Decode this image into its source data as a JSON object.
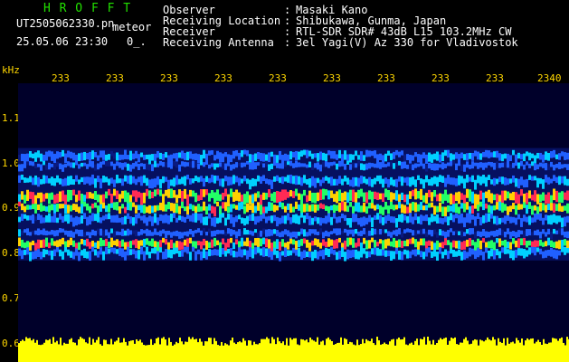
{
  "header": {
    "app_title": "H R O F F T",
    "file_name": "UT2505062330.pn",
    "meteor_label": "meteor",
    "datetime": "25.05.06 23:30",
    "counter": "0_."
  },
  "metadata": [
    {
      "label": "Observer",
      "value": "Masaki Kano"
    },
    {
      "label": "Receiving Location",
      "value": "Shibukawa, Gunma, Japan"
    },
    {
      "label": "Receiver",
      "value": "RTL-SDR SDR# 43dB L15 103.2MHz CW"
    },
    {
      "label": "Receiving Antenna",
      "value": "3el Yagi(V) Az 330 for Vladivostok"
    }
  ],
  "separator": ":",
  "axis": {
    "unit": "kHz",
    "time_ticks": [
      "233",
      "233",
      "233",
      "233",
      "233",
      "233",
      "233",
      "233",
      "233",
      "2340"
    ],
    "freq_labels": [
      "1.1",
      "1.0",
      "0.9",
      "0.8",
      "0.7",
      "0.6"
    ]
  },
  "colors": {
    "title_green": "#22e000",
    "axis_yellow": "#ffd700",
    "signal_yellow": "#ffff00"
  },
  "spectrogram": {
    "freq_min_khz": 0.6,
    "freq_max_khz": 1.1,
    "bands": [
      {
        "center_khz": 1.02,
        "width_khz": 0.02,
        "level": 0.45
      },
      {
        "center_khz": 1.0,
        "width_khz": 0.015,
        "level": 0.4
      },
      {
        "center_khz": 0.965,
        "width_khz": 0.02,
        "level": 0.5
      },
      {
        "center_khz": 0.93,
        "width_khz": 0.025,
        "level": 0.95
      },
      {
        "center_khz": 0.905,
        "width_khz": 0.02,
        "level": 0.85
      },
      {
        "center_khz": 0.88,
        "width_khz": 0.02,
        "level": 0.45
      },
      {
        "center_khz": 0.85,
        "width_khz": 0.015,
        "level": 0.4
      },
      {
        "center_khz": 0.825,
        "width_khz": 0.02,
        "level": 0.95
      },
      {
        "center_khz": 0.805,
        "width_khz": 0.02,
        "level": 0.5
      }
    ]
  }
}
